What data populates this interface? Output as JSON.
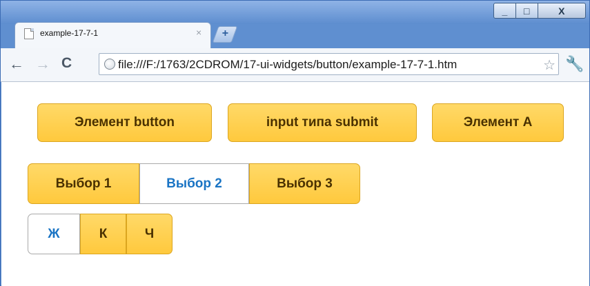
{
  "browser": {
    "tab_title": "example-17-7-1",
    "tab_close": "×",
    "new_tab": "+",
    "url": "file:///F:/1763/2CDROM/17-ui-widgets/button/example-17-7-1.htm",
    "window_controls": {
      "minimize": "_",
      "maximize": "□",
      "close": "X"
    },
    "toolbar": {
      "back": "←",
      "forward": "→",
      "reload": "C",
      "bookmark": "☆",
      "menu": "🔧"
    }
  },
  "buttons": [
    {
      "label": "Элемент button"
    },
    {
      "label": "input типа submit"
    },
    {
      "label": "Элемент A"
    }
  ],
  "radio_group": [
    {
      "label": "Выбор 1",
      "active": false
    },
    {
      "label": "Выбор 2",
      "active": true
    },
    {
      "label": "Выбор 3",
      "active": false
    }
  ],
  "check_group": [
    {
      "label": "Ж",
      "active": true
    },
    {
      "label": "К",
      "active": false
    },
    {
      "label": "Ч",
      "active": false
    }
  ],
  "colors": {
    "button_bg": "#ffc93d",
    "button_text": "#4a3100",
    "active_text": "#1a74c4"
  }
}
